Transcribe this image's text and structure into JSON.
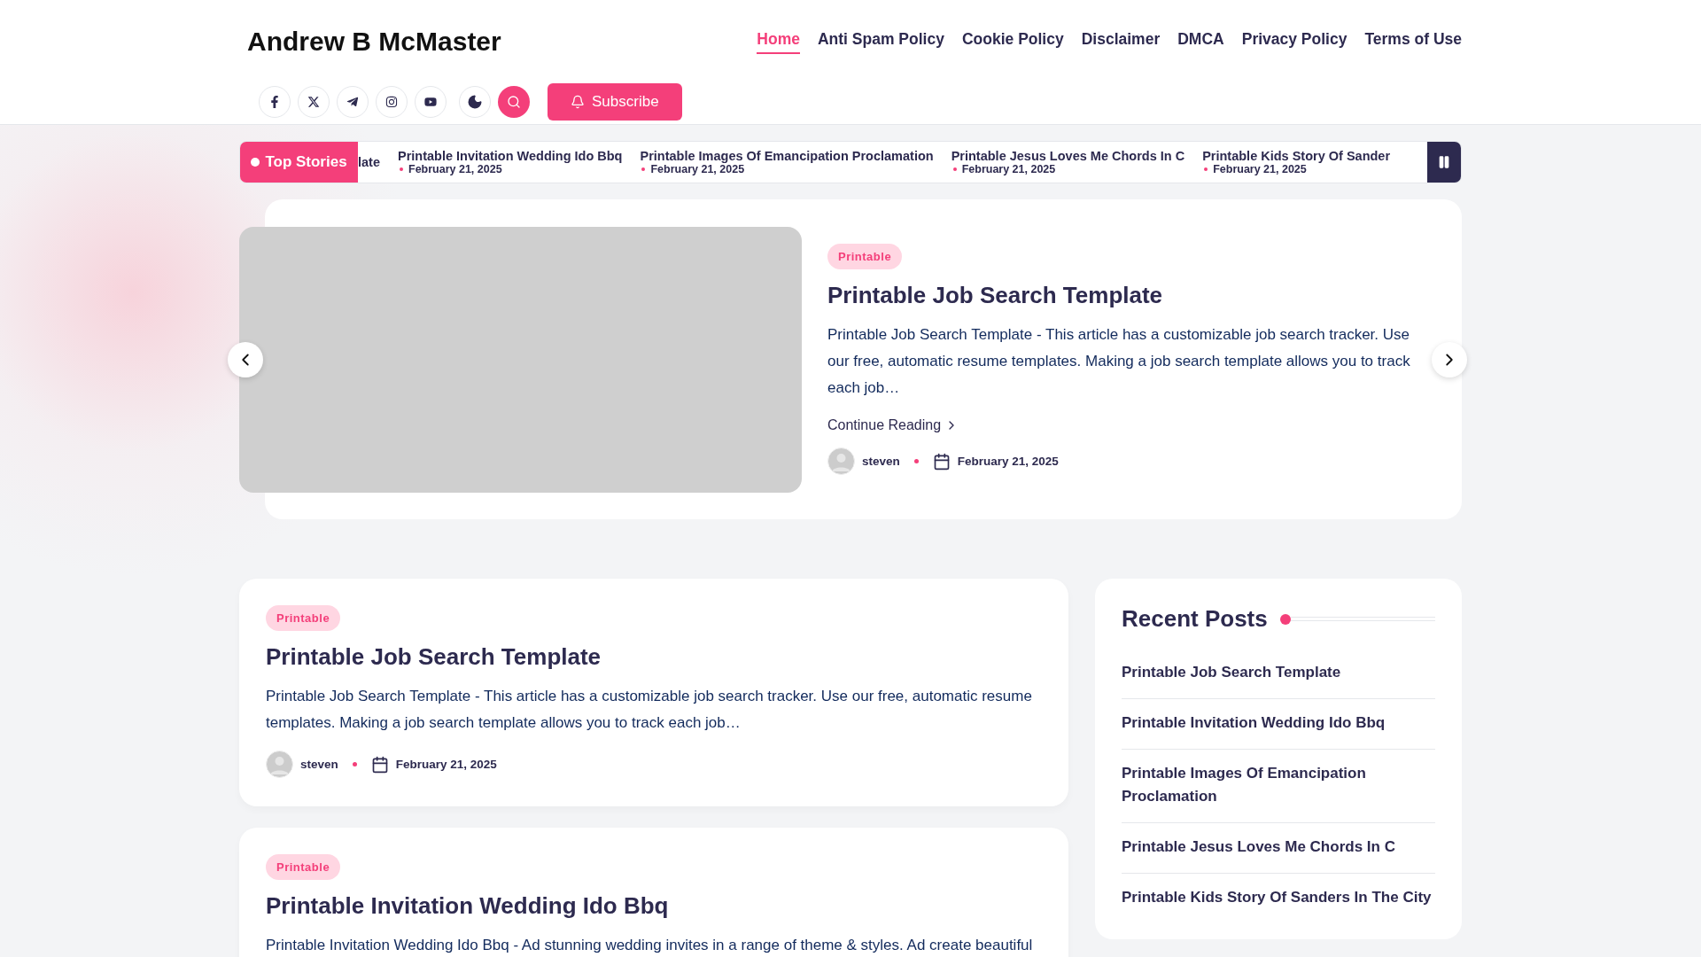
{
  "site_title": "Andrew B McMaster",
  "nav": [
    {
      "label": "Home",
      "selected": true
    },
    {
      "label": "Anti Spam Policy",
      "selected": false
    },
    {
      "label": "Cookie Policy",
      "selected": false
    },
    {
      "label": "Disclaimer",
      "selected": false
    },
    {
      "label": "DMCA",
      "selected": false
    },
    {
      "label": "Privacy Policy",
      "selected": false
    },
    {
      "label": "Terms of Use",
      "selected": false
    }
  ],
  "subscribe_button": "Subscribe",
  "ticker": {
    "label": "Top Stories",
    "items": [
      {
        "title": "late"
      },
      {
        "title": "Printable Invitation Wedding Ido Bbq",
        "date": "February 21, 2025"
      },
      {
        "title": "Printable Images Of Emancipation Proclamation",
        "date": "February 21, 2025"
      },
      {
        "title": "Printable Jesus Loves Me Chords In C",
        "date": "February 21, 2025"
      },
      {
        "title": "Printable Kids Story Of Sander",
        "date": "February 21, 2025"
      }
    ]
  },
  "hero": {
    "category": "Printable",
    "title": "Printable Job Search Template",
    "excerpt": "Printable Job Search Template - This article has a customizable job search tracker. Use our free, automatic resume templates. Making a job search template allows you to track each job…",
    "link": "Continue Reading",
    "author": "steven",
    "date": "February 21, 2025"
  },
  "posts": [
    {
      "category": "Printable",
      "title": "Printable Job Search Template",
      "excerpt": "Printable Job Search Template - This article has a customizable job search tracker. Use our free, automatic resume templates. Making a job search template allows you to track each job…",
      "author": "steven",
      "date": "February 21, 2025"
    },
    {
      "category": "Printable",
      "title": "Printable Invitation Wedding Ido Bbq",
      "excerpt": "Printable Invitation Wedding Ido Bbq - Ad stunning wedding invites in a range of theme & styles. Ad create beautiful"
    }
  ],
  "sidebar": {
    "title": "Recent Posts",
    "items": [
      "Printable Job Search Template",
      "Printable Invitation Wedding Ido Bbq",
      "Printable Images Of Emancipation Proclamation",
      "Printable Jesus Loves Me Chords In C",
      "Printable Kids Story Of Sanders In The City"
    ]
  }
}
